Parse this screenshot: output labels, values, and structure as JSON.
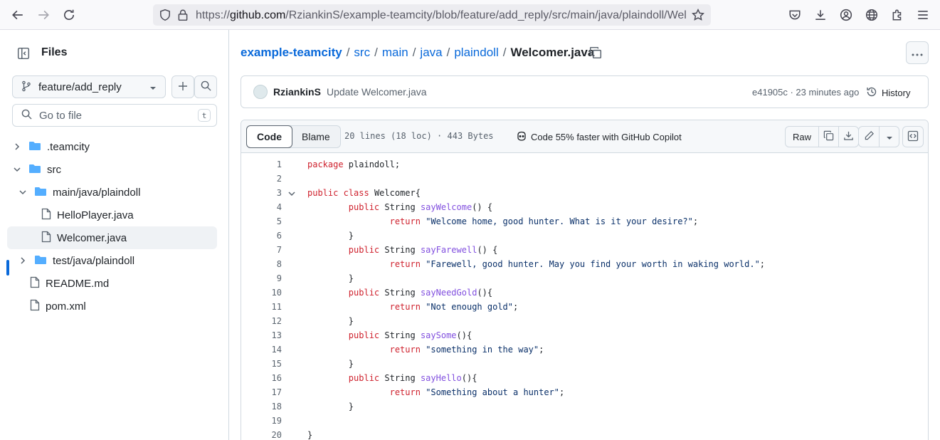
{
  "browser": {
    "url_prefix": "https://",
    "url_host": "github.com",
    "url_path": "/RziankinS/example-teamcity/blob/feature/add_reply/src/main/java/plaindoll/Welcomer.java"
  },
  "sidebar": {
    "title": "Files",
    "branch": "feature/add_reply",
    "goto_placeholder": "Go to file",
    "goto_shortcut": "t",
    "tree": [
      {
        "label": ".teamcity",
        "type": "folder",
        "expanded": false
      },
      {
        "label": "src",
        "type": "folder",
        "expanded": true
      },
      {
        "label": "main/java/plaindoll",
        "type": "folder",
        "expanded": true
      },
      {
        "label": "HelloPlayer.java",
        "type": "file"
      },
      {
        "label": "Welcomer.java",
        "type": "file",
        "selected": true
      },
      {
        "label": "test/java/plaindoll",
        "type": "folder",
        "expanded": false
      },
      {
        "label": "README.md",
        "type": "file"
      },
      {
        "label": "pom.xml",
        "type": "file"
      }
    ]
  },
  "breadcrumb": {
    "repo": "example-teamcity",
    "parts": [
      "src",
      "main",
      "java",
      "plaindoll"
    ],
    "sep": "/",
    "current": "Welcomer.java"
  },
  "commit": {
    "author": "RziankinS",
    "message": "Update Welcomer.java",
    "meta": "e41905c · 23 minutes ago",
    "history_label": "History"
  },
  "file": {
    "tab_code": "Code",
    "tab_blame": "Blame",
    "meta": "20 lines (18 loc) · 443 Bytes",
    "copilot": "Code 55% faster with GitHub Copilot",
    "raw_label": "Raw",
    "lines": [
      [
        {
          "t": "package",
          "c": "kw"
        },
        {
          "t": " plaindoll;"
        }
      ],
      [],
      [
        {
          "t": "public",
          "c": "kw"
        },
        {
          "t": " "
        },
        {
          "t": "class",
          "c": "kw"
        },
        {
          "t": " Welcomer{"
        }
      ],
      [
        {
          "t": "        "
        },
        {
          "t": "public",
          "c": "kw"
        },
        {
          "t": " String "
        },
        {
          "t": "sayWelcome",
          "c": "fn"
        },
        {
          "t": "() {"
        }
      ],
      [
        {
          "t": "                "
        },
        {
          "t": "return",
          "c": "kw"
        },
        {
          "t": " "
        },
        {
          "t": "\"Welcome home, good hunter. What is it your desire?\"",
          "c": "str"
        },
        {
          "t": ";"
        }
      ],
      [
        {
          "t": "        }"
        }
      ],
      [
        {
          "t": "        "
        },
        {
          "t": "public",
          "c": "kw"
        },
        {
          "t": " String "
        },
        {
          "t": "sayFarewell",
          "c": "fn"
        },
        {
          "t": "() {"
        }
      ],
      [
        {
          "t": "                "
        },
        {
          "t": "return",
          "c": "kw"
        },
        {
          "t": " "
        },
        {
          "t": "\"Farewell, good hunter. May you find your worth in waking world.\"",
          "c": "str"
        },
        {
          "t": ";"
        }
      ],
      [
        {
          "t": "        }"
        }
      ],
      [
        {
          "t": "        "
        },
        {
          "t": "public",
          "c": "kw"
        },
        {
          "t": " String "
        },
        {
          "t": "sayNeedGold",
          "c": "fn"
        },
        {
          "t": "(){"
        }
      ],
      [
        {
          "t": "                "
        },
        {
          "t": "return",
          "c": "kw"
        },
        {
          "t": " "
        },
        {
          "t": "\"Not enough gold\"",
          "c": "str"
        },
        {
          "t": ";"
        }
      ],
      [
        {
          "t": "        }"
        }
      ],
      [
        {
          "t": "        "
        },
        {
          "t": "public",
          "c": "kw"
        },
        {
          "t": " String "
        },
        {
          "t": "saySome",
          "c": "fn"
        },
        {
          "t": "(){"
        }
      ],
      [
        {
          "t": "                "
        },
        {
          "t": "return",
          "c": "kw"
        },
        {
          "t": " "
        },
        {
          "t": "\"something in the way\"",
          "c": "str"
        },
        {
          "t": ";"
        }
      ],
      [
        {
          "t": "        }"
        }
      ],
      [
        {
          "t": "        "
        },
        {
          "t": "public",
          "c": "kw"
        },
        {
          "t": " String "
        },
        {
          "t": "sayHello",
          "c": "fn"
        },
        {
          "t": "(){"
        }
      ],
      [
        {
          "t": "                "
        },
        {
          "t": "return",
          "c": "kw"
        },
        {
          "t": " "
        },
        {
          "t": "\"Something about a hunter\"",
          "c": "str"
        },
        {
          "t": ";"
        }
      ],
      [
        {
          "t": "        }"
        }
      ],
      [],
      [
        {
          "t": "}"
        }
      ]
    ]
  }
}
